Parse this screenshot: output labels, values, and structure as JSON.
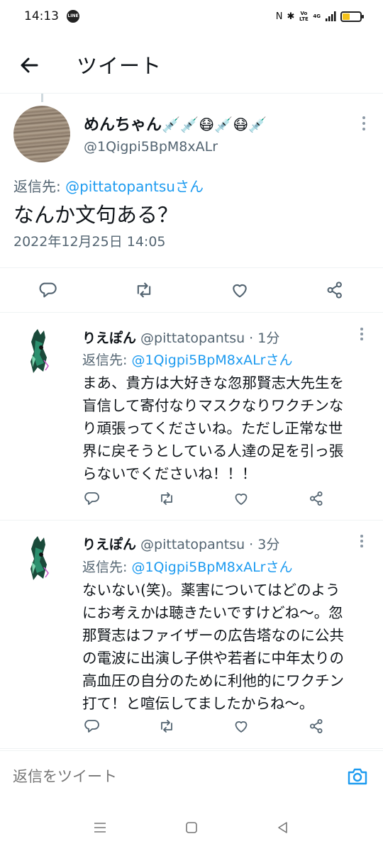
{
  "status_bar": {
    "time": "14:13",
    "line_app_label": "LINE",
    "network_label": "4G",
    "volte_label": "Vo LTE"
  },
  "header": {
    "title": "ツイート"
  },
  "main_tweet": {
    "display_name": "めんちゃん",
    "name_emojis": "💉💉😷💉😷💉",
    "handle": "@1Qigpi5BpM8xALr",
    "reply_to_label": "返信先: ",
    "reply_to_mention": "@pittatopantsuさん",
    "text": "なんか文句ある？",
    "timestamp": "2022年12月25日 14:05"
  },
  "replies": [
    {
      "display_name": "りえぽん",
      "handle_time": " @pittatopantsu · 1分",
      "reply_to_label": "返信先: ",
      "reply_to_mention": "@1Qigpi5BpM8xALrさん",
      "lines": [
        "まあ、貴方は大好きな忽那賢志大先生を",
        "盲信して寄付なりマスクなりワクチンな",
        "り頑張ってくださいね。ただし正常な世",
        "界に戻そうとしている人達の足を引っ張",
        "らないでくださいね！！！"
      ]
    },
    {
      "display_name": "りえぽん",
      "handle_time": " @pittatopantsu · 3分",
      "reply_to_label": "返信先: ",
      "reply_to_mention": "@1Qigpi5BpM8xALrさん",
      "lines": [
        "ないない(笑)。薬害についてはどのよう",
        "にお考えかは聴きたいですけどね〜。忽",
        "那賢志はファイザーの広告塔なのに公共",
        "の電波に出演し子供や若者に中年太りの",
        "高血圧の自分のために利他的にワクチン",
        "打て！と喧伝してましたからね〜。"
      ]
    }
  ],
  "compose": {
    "placeholder": "返信をツイート"
  },
  "colors": {
    "accent": "#1d9bf0",
    "text": "#0f1419",
    "secondary": "#536471",
    "battery": "#f4c21a"
  },
  "icons": [
    "back-arrow-icon",
    "more-icon",
    "reply-icon",
    "retweet-icon",
    "like-icon",
    "share-icon",
    "camera-icon",
    "menu-icon",
    "home-icon",
    "back-nav-icon"
  ]
}
